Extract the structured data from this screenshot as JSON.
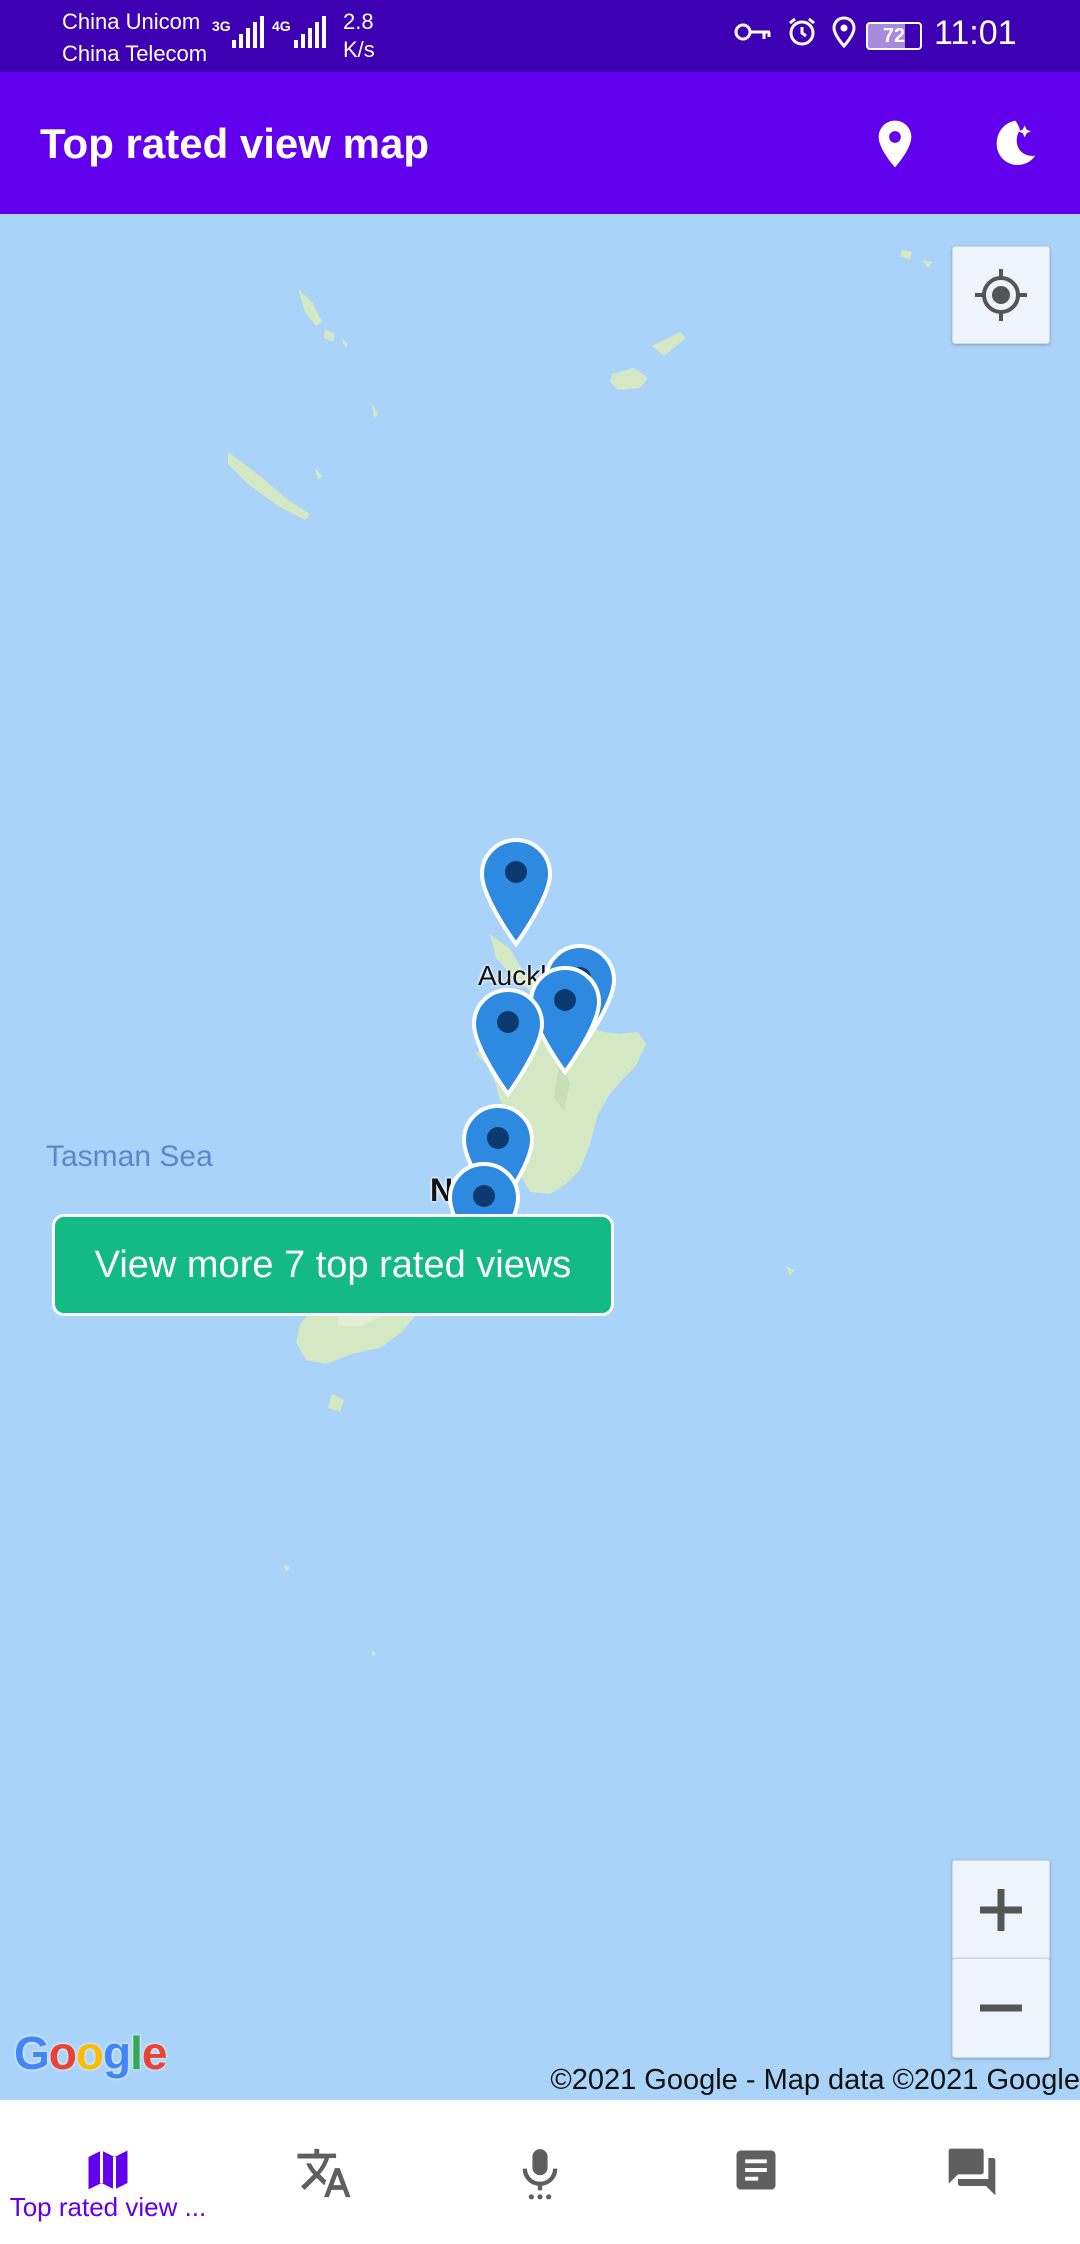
{
  "status_bar": {
    "carrier_1": "China Unicom",
    "carrier_2": "China Telecom",
    "net_1": "3G",
    "net_2": "4G",
    "speed_value": "2.8",
    "speed_unit": "K/s",
    "battery": "72",
    "time": "11:01"
  },
  "app_bar": {
    "title": "Top rated view map",
    "actions": [
      "location-pin-icon",
      "night-mode-icon"
    ]
  },
  "map": {
    "sea_label": "Tasman Sea",
    "city_label": "Auckl",
    "partial_label": "N",
    "markers_count": 6,
    "cta_button": "View more 7 top rated views",
    "logo": "Google",
    "attribution": "©2021 Google - Map data ©2021 Google",
    "controls": [
      "my-location",
      "zoom-in",
      "zoom-out"
    ]
  },
  "bottom_nav": {
    "items": [
      {
        "icon": "map-icon",
        "label": "Top rated view ...",
        "active": true
      },
      {
        "icon": "translate-icon",
        "label": ""
      },
      {
        "icon": "microphone-icon",
        "label": ""
      },
      {
        "icon": "document-icon",
        "label": ""
      },
      {
        "icon": "chat-icon",
        "label": ""
      }
    ]
  },
  "colors": {
    "status_bar": "#3d00b3",
    "app_bar": "#6200ee",
    "water": "#aad3f9",
    "land": "#d4e8c4",
    "marker": "#2d8ae0",
    "cta": "#13ba83",
    "nav_active": "#6200ee",
    "nav_inactive": "#5f5f5f"
  }
}
